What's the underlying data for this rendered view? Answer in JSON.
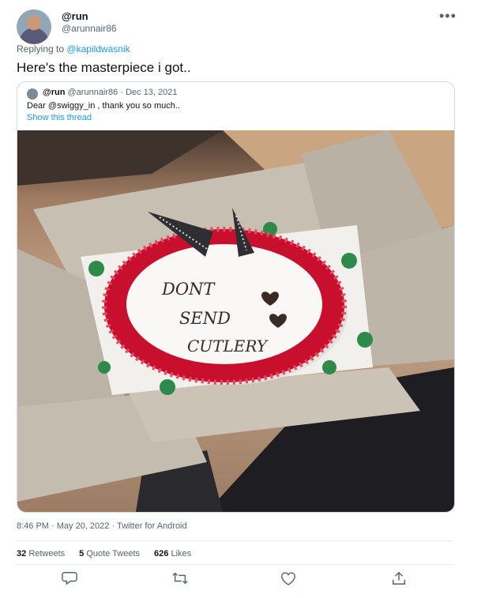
{
  "tweet": {
    "author_name": "@run",
    "author_handle": "@arunnair86",
    "more_icon": "•••",
    "replying_prefix": "Replying to",
    "replying_mention": "@kapildwasnik",
    "text": "Here's the masterpiece i got..",
    "timestamp": "8:46 PM · May 20, 2022 · Twitter for Android"
  },
  "quote": {
    "author_name": "@run",
    "author_handle": "@arunnair86",
    "date": "· Dec 13, 2021",
    "text": "Dear @swiggy_in , thank you so much..",
    "show_thread": "Show this thread"
  },
  "photo": {
    "cake_text_line1": "DONT",
    "cake_text_line2": "SEND",
    "cake_text_line3": "CUTLERY"
  },
  "stats": {
    "retweets_count": "32",
    "retweets_label": "Retweets",
    "quotes_count": "5",
    "quotes_label": "Quote Tweets",
    "likes_count": "626",
    "likes_label": "Likes"
  },
  "actions": [
    "reply-icon",
    "retweet-icon",
    "like-icon",
    "share-icon"
  ]
}
